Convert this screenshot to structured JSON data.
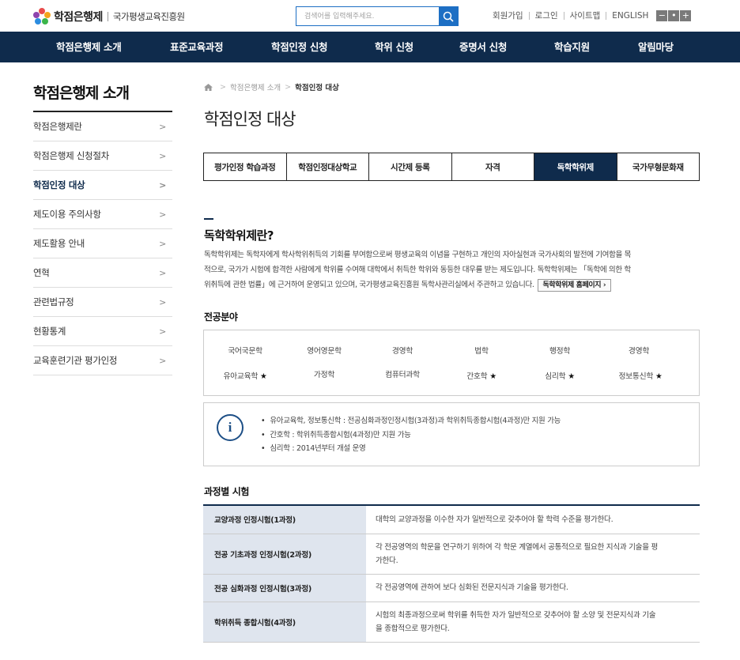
{
  "header": {
    "logo_name": "학점은행제",
    "logo_org": "국가평생교육진흥원",
    "search_placeholder": "검색어를 입력해주세요.",
    "util_links": [
      "회원가입",
      "로그인",
      "사이트맵",
      "ENGLISH"
    ],
    "zoom": [
      "−",
      "•",
      "+"
    ],
    "colors": {
      "nav": "#0f2b4c",
      "accent": "#1d6fc4"
    }
  },
  "gnb": [
    "학점은행제 소개",
    "표준교육과정",
    "학점인정 신청",
    "학위 신청",
    "증명서 신청",
    "학습지원",
    "알림마당"
  ],
  "sidebar": {
    "title": "학점은행제 소개",
    "items": [
      "학점은행제란",
      "학점은행제 신청절차",
      "학점인정 대상",
      "제도이용 주의사항",
      "제도활용 안내",
      "연혁",
      "관련법규정",
      "현황통계",
      "교육훈련기관 평가인정"
    ],
    "active": "학점인정 대상"
  },
  "breadcrumb": {
    "home_icon": "home-icon",
    "items": [
      "학점은행제 소개",
      "학점인정 대상"
    ]
  },
  "page_title": "학점인정 대상",
  "tabs": {
    "items": [
      "평가인정 학습과정",
      "학점인정대상학교",
      "시간제 등록",
      "자격",
      "독학학위제",
      "국가무형문화재"
    ],
    "active": "독학학위제"
  },
  "section": {
    "title": "독학학위제란?",
    "desc_lines": [
      "독학학위제는 독학자에게 학사학위취득의 기회를 부여함으로써 평생교육의 이념을 구현하고 개인의 자아실현과 국가사회의 발전에 기여함을 목",
      "적으로, 국가가 시험에 합격한 사람에게 학위를 수여해 대학에서 취득한 학위와 동등한 대우를 받는 제도입니다. 독학학위제는 「독학에 의한 학",
      "위취득에 관한 법률」에 근거하여 운영되고 있으며, 국가평생교육진흥원 독학사관리실에서 주관하고 있습니다."
    ],
    "home_button": "독학학위제 홈페이지 ›"
  },
  "majors": {
    "title": "전공분야",
    "items": [
      "국어국문학",
      "영어영문학",
      "경영학",
      "법학",
      "행정학",
      "경영학",
      "유아교육학",
      "가정학",
      "컴퓨터과학",
      "간호학",
      "심리학",
      "정보통신학"
    ],
    "star": "★"
  },
  "notice": {
    "icon": "info-icon",
    "icon_glyph": "i",
    "items": [
      "유아교육학, 정보통신학 : 전공심화과정인정시험(3과정)과 학위취득종합시험(4과정)만 지원 가능",
      "간호학 : 학위취득종합시험(4과정)만 지원 가능",
      "심리학 : 2014년부터 개설 운영"
    ]
  },
  "exams": {
    "title": "과정별 시험",
    "rows": [
      {
        "name": "교양과정 인정시험(1과정)",
        "desc": [
          "대학의 교양과정을 이수한 자가 일반적으로 갖추어야 할 학력 수준을 평가한다."
        ]
      },
      {
        "name": "전공 기초과정 인정시험(2과정)",
        "desc": [
          "각 전공영역의 학문을 연구하기 위하여 각 학문 계열에서 공통적으로 필요한 지식과 기술을 평",
          "가한다."
        ]
      },
      {
        "name": "전공 심화과정 인정시험(3과정)",
        "desc": [
          "각 전공영역에 관하여 보다 심화된 전문지식과 기술을 평가한다."
        ]
      },
      {
        "name": "학위취득 종합시험(4과정)",
        "desc": [
          "시험의 최종과정으로써 학위를 취득한 자가 일반적으로 갖추어야 할 소양 및 전문지식과 기술",
          "을 종합적으로 평가한다."
        ]
      }
    ]
  }
}
